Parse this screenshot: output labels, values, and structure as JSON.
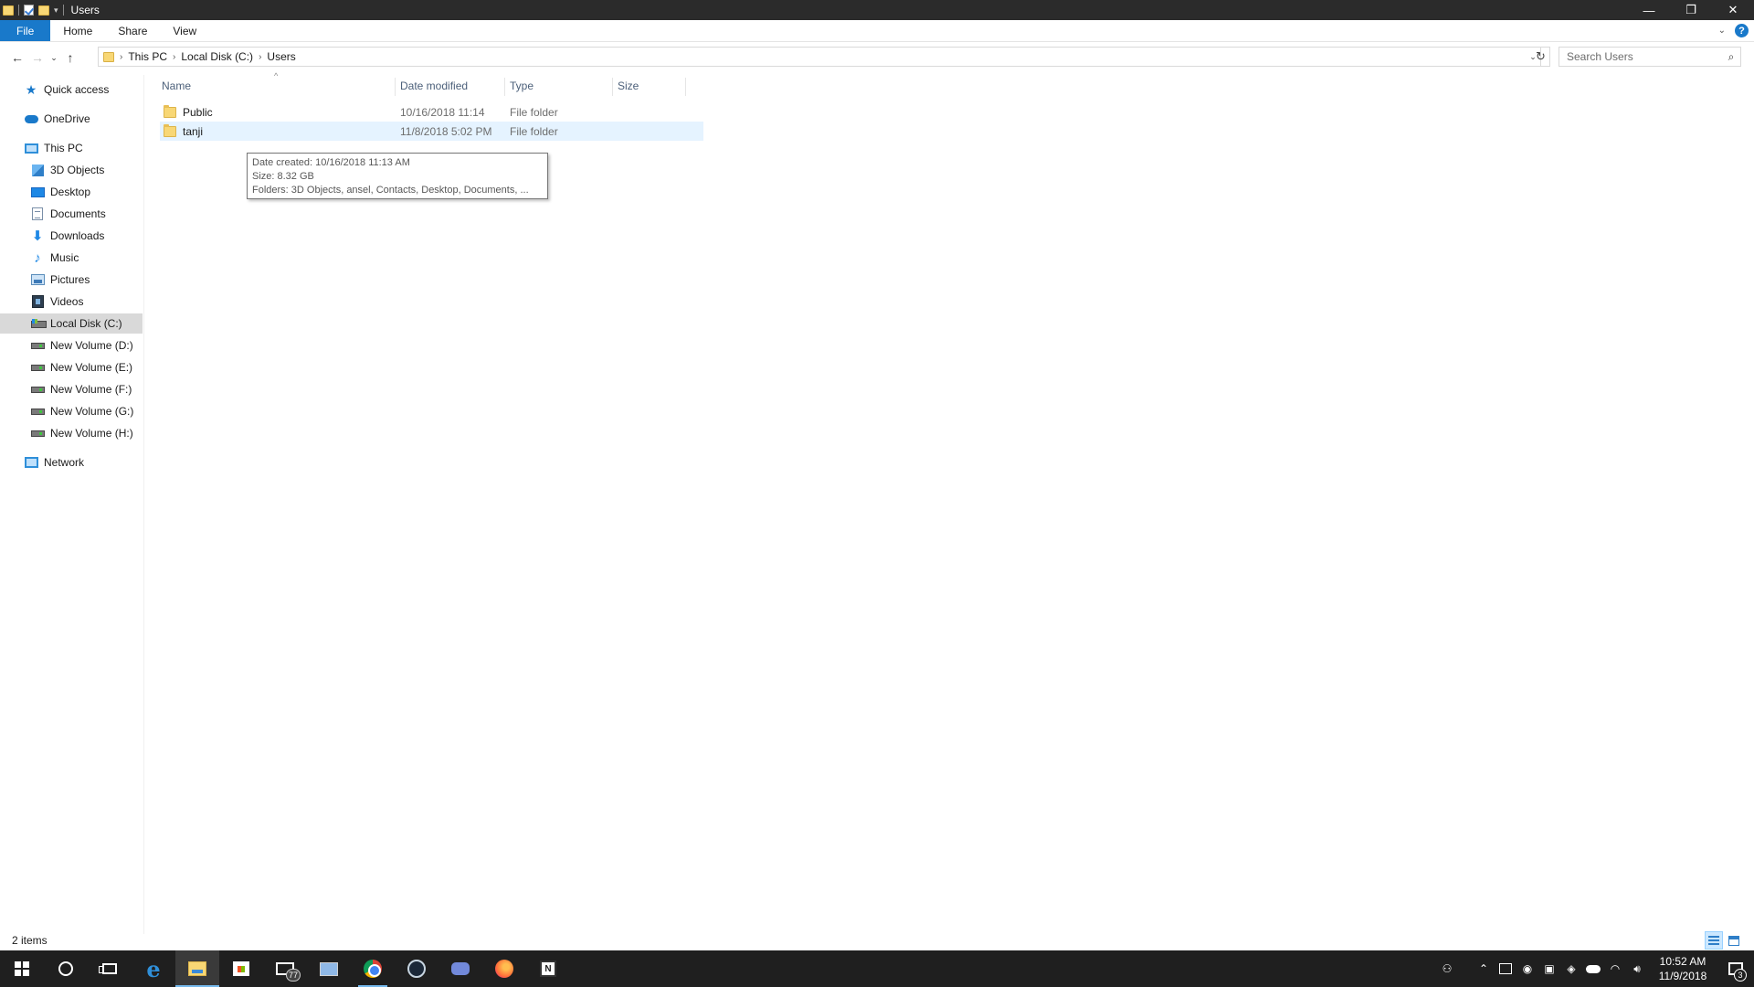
{
  "window": {
    "title": "Users",
    "min_glyph": "—",
    "restore_glyph": "❐",
    "close_glyph": "✕"
  },
  "ribbon": {
    "tabs": [
      "File",
      "Home",
      "Share",
      "View"
    ],
    "help_glyph": "?"
  },
  "address": {
    "crumbs": [
      "This PC",
      "Local Disk (C:)",
      "Users"
    ],
    "search_placeholder": "Search Users"
  },
  "sidebar": {
    "quick_access": "Quick access",
    "onedrive": "OneDrive",
    "this_pc": "This PC",
    "items": [
      {
        "label": "3D Objects",
        "icon": "cube-icon"
      },
      {
        "label": "Desktop",
        "icon": "desktop-icon"
      },
      {
        "label": "Documents",
        "icon": "documents-icon"
      },
      {
        "label": "Downloads",
        "icon": "downloads-icon"
      },
      {
        "label": "Music",
        "icon": "music-icon"
      },
      {
        "label": "Pictures",
        "icon": "pictures-icon"
      },
      {
        "label": "Videos",
        "icon": "videos-icon"
      },
      {
        "label": "Local Disk (C:)",
        "icon": "system-drive-icon",
        "selected": true
      },
      {
        "label": "New Volume (D:)",
        "icon": "drive-icon"
      },
      {
        "label": "New Volume (E:)",
        "icon": "drive-icon"
      },
      {
        "label": "New Volume (F:)",
        "icon": "drive-icon"
      },
      {
        "label": "New Volume (G:)",
        "icon": "drive-icon"
      },
      {
        "label": "New Volume (H:)",
        "icon": "drive-icon"
      }
    ],
    "network": "Network"
  },
  "columns": {
    "name": "Name",
    "date_modified": "Date modified",
    "type": "Type",
    "size": "Size"
  },
  "files": [
    {
      "name": "Public",
      "date": "10/16/2018 11:14",
      "type": "File folder",
      "size": ""
    },
    {
      "name": "tanji",
      "date": "11/8/2018 5:02 PM",
      "type": "File folder",
      "size": "",
      "hover": true
    }
  ],
  "tooltip": {
    "date_created": "Date created: 10/16/2018 11:13 AM",
    "size": "Size: 8.32 GB",
    "folders": "Folders: 3D Objects, ansel, Contacts, Desktop, Documents, ..."
  },
  "status": {
    "count": "2 items"
  },
  "taskbar": {
    "mail_badge": "77",
    "time": "10:52 AM",
    "date": "11/9/2018",
    "notification_count": "3"
  },
  "colors": {
    "accent": "#1979ca",
    "selection": "#d9d9d9",
    "hover_row": "#e5f3ff",
    "taskbar": "#1f1f1f"
  }
}
